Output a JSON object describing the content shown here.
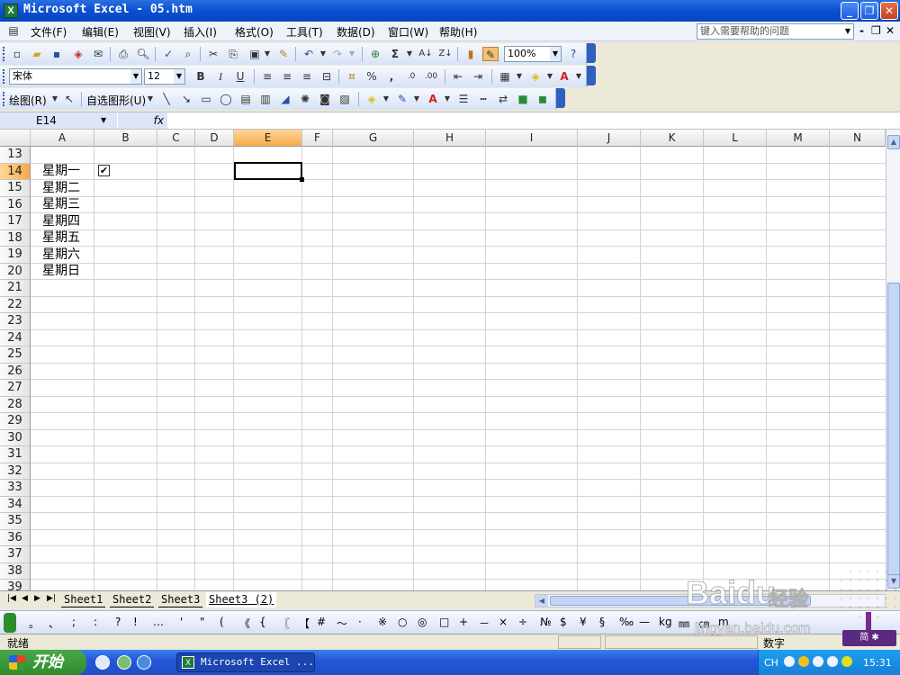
{
  "window": {
    "title": "Microsoft Excel - 05.htm",
    "app_icon": "X"
  },
  "menu": [
    "文件(F)",
    "编辑(E)",
    "视图(V)",
    "插入(I)",
    "格式(O)",
    "工具(T)",
    "数据(D)",
    "窗口(W)",
    "帮助(H)"
  ],
  "help_placeholder": "键入需要帮助的问题",
  "standard_toolbar": {
    "zoom": "100%"
  },
  "format_toolbar": {
    "font": "宋体",
    "size": "12",
    "bold": "B",
    "italic": "I",
    "underline": "U",
    "percent": "%",
    "comma": ","
  },
  "drawing_toolbar": {
    "draw_label": "绘图(R)",
    "autoshapes_label": "自选图形(U)"
  },
  "formula_bar": {
    "name_box": "E14",
    "fx": "fx"
  },
  "columns": [
    "A",
    "B",
    "C",
    "D",
    "E",
    "F",
    "G",
    "H",
    "I",
    "J",
    "K",
    "L",
    "M",
    "N"
  ],
  "selected_column": "E",
  "rows": [
    "13",
    "14",
    "15",
    "16",
    "17",
    "18",
    "19",
    "20",
    "21",
    "22",
    "23",
    "24",
    "25",
    "26",
    "27",
    "28",
    "29",
    "30",
    "31",
    "32",
    "33",
    "34",
    "35",
    "36",
    "37",
    "38",
    "39"
  ],
  "selected_row": "14",
  "cells": {
    "A14": "星期一",
    "A15": "星期二",
    "A16": "星期三",
    "A17": "星期四",
    "A18": "星期五",
    "A19": "星期六",
    "A20": "星期日",
    "B14": "✔"
  },
  "sheet_tabs": [
    "Sheet1",
    "Sheet2",
    "Sheet3",
    "Sheet3 (2)"
  ],
  "active_sheet": "Sheet3 (2)",
  "symbols": [
    "。",
    "、",
    ";",
    ":",
    "?",
    "!",
    "…",
    "'",
    "\"",
    "(",
    "《",
    "{",
    "〖",
    "【",
    "#",
    "～",
    "·",
    "※",
    "○",
    "◎",
    "□",
    "+",
    "－",
    "×",
    "÷",
    "№",
    "$",
    "¥",
    "§",
    "‰",
    "—",
    "kg",
    "㎜",
    "㎝",
    "m"
  ],
  "status": {
    "ready": "就绪",
    "numlock": "数字"
  },
  "taskbar": {
    "start": "开始",
    "item": "Microsoft Excel ...",
    "lang": "CH",
    "time": "15:31"
  },
  "watermark": {
    "logo": "Baidu",
    "jingyan": "经验",
    "url": "jingyan.baidu.com",
    "badge": "简 ✱"
  }
}
